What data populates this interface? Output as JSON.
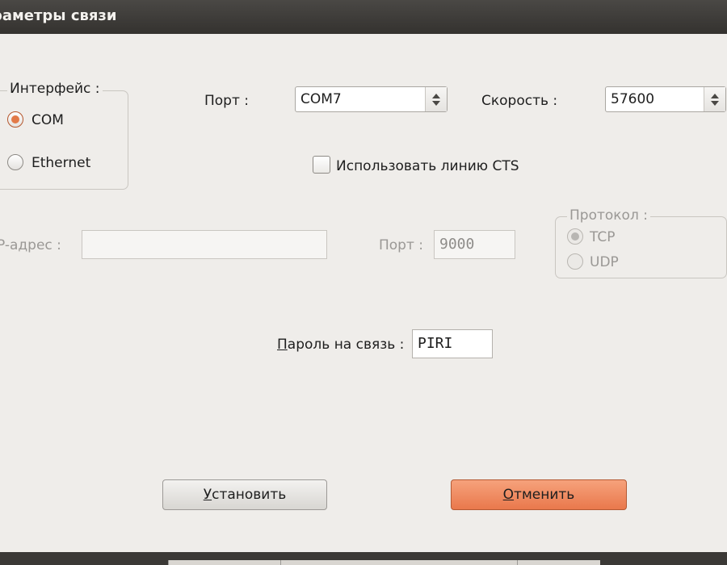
{
  "window": {
    "title": "раметры связи"
  },
  "interface_group": {
    "legend": "Интерфейс :",
    "options": [
      {
        "label": "COM",
        "checked": true
      },
      {
        "label": "Ethernet",
        "checked": false
      }
    ]
  },
  "port": {
    "label": "Порт :",
    "value": "COM7"
  },
  "speed": {
    "label": "Скорость :",
    "value": "57600"
  },
  "cts": {
    "label": "Использовать линию CTS",
    "checked": false
  },
  "ip": {
    "label": "P-адрес :",
    "value": ""
  },
  "net_port": {
    "label": "Порт :",
    "value": "9000"
  },
  "protocol_group": {
    "legend": "Протокол :",
    "options": [
      {
        "label": "TCP",
        "checked": true
      },
      {
        "label": "UDP",
        "checked": false
      }
    ]
  },
  "password": {
    "label": "Пароль на связь :",
    "value": "PIRI"
  },
  "buttons": {
    "set": "Установить",
    "cancel": "Отменить"
  },
  "colors": {
    "accent": "#e27a48",
    "cancel_button": "#ef8a5f",
    "titlebar": "#3d3b38",
    "background": "#efedea"
  }
}
